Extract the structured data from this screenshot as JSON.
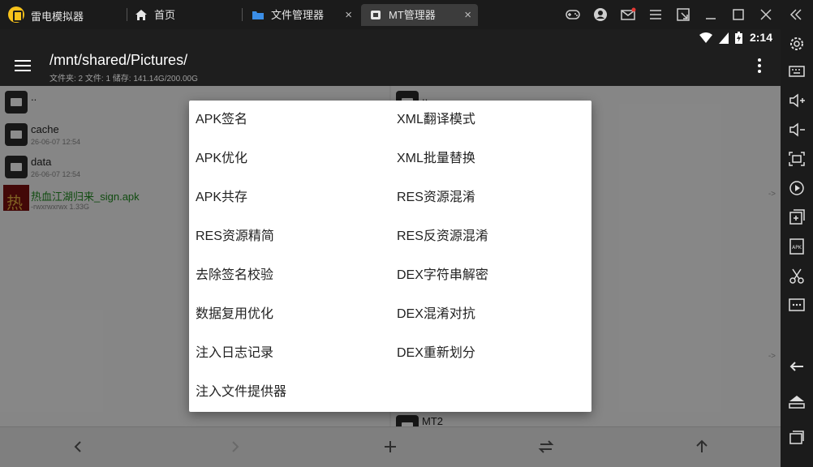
{
  "window": {
    "app_name": "雷电模拟器",
    "tabs": [
      {
        "label": "首页",
        "icon": "home-icon"
      },
      {
        "label": "文件管理器",
        "icon": "folder-icon",
        "close": "×"
      },
      {
        "label": "MT管理器",
        "icon": "app-icon",
        "close": "×",
        "active": true
      }
    ],
    "controls": [
      "gamepad-icon",
      "avatar-icon",
      "mail-icon",
      "menu-icon",
      "popout-icon",
      "minimize-icon",
      "maximize-icon",
      "close-icon",
      "collapse-icon"
    ]
  },
  "status_bar": {
    "time": "2:14"
  },
  "app_bar": {
    "path": "/mnt/shared/Pictures/",
    "info": "文件夹: 2  文件: 1  储存: 141.14G/200.00G"
  },
  "left_pane": {
    "items": [
      {
        "name": "..",
        "meta": "",
        "type": "folder"
      },
      {
        "name": "cache",
        "meta": "26-06-07 12:54",
        "type": "folder"
      },
      {
        "name": "data",
        "meta": "26-06-07 12:54",
        "type": "folder"
      },
      {
        "name": "热血江湖归来_sign.apk",
        "meta": "-rwxrwxrwx  1.33G",
        "type": "apk"
      }
    ]
  },
  "right_pane": {
    "items": [
      {
        "name": "..",
        "type": "folder"
      },
      {
        "name": "MT2",
        "type": "folder"
      }
    ],
    "arrows": [
      "->",
      "->"
    ]
  },
  "dialog": {
    "col1": [
      "APK签名",
      "APK优化",
      "APK共存",
      "RES资源精简",
      "去除签名校验",
      "数据复用优化",
      "注入日志记录",
      "注入文件提供器"
    ],
    "col2": [
      "XML翻译模式",
      "XML批量替换",
      "RES资源混淆",
      "RES反资源混淆",
      "DEX字符串解密",
      "DEX混淆对抗",
      "DEX重新划分"
    ]
  },
  "bottom_bar": {
    "buttons": [
      "back-arrow-icon",
      "forward-arrow-icon",
      "add-icon",
      "swap-icon",
      "up-arrow-icon"
    ]
  },
  "sidebar": {
    "buttons": [
      "settings-icon",
      "keyboard-icon",
      "volume-up-icon",
      "volume-down-icon",
      "screenshot-icon",
      "record-icon",
      "add-app-icon",
      "apk-install-icon",
      "scissors-icon",
      "more-icon",
      "android-back-icon",
      "android-home-icon",
      "android-recent-icon"
    ]
  }
}
